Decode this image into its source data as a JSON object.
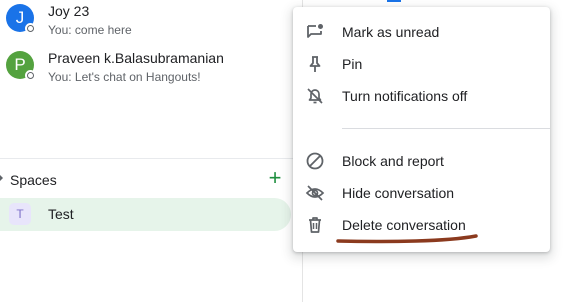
{
  "contacts": [
    {
      "initial": "J",
      "name": "Joy 23",
      "preview": "You: come here",
      "color": "#1a73e8"
    },
    {
      "initial": "P",
      "name": "Praveen k.Balasubramanian",
      "preview": "You: Let's chat on Hangouts!",
      "color": "#54a23f"
    }
  ],
  "spaces": {
    "header": "Spaces",
    "add_icon": "plus-icon",
    "items": [
      {
        "initial": "T",
        "name": "Test"
      }
    ]
  },
  "context_menu": {
    "items": [
      {
        "label": "Mark as unread",
        "icon": "mark-unread-icon"
      },
      {
        "label": "Pin",
        "icon": "pin-icon"
      },
      {
        "label": "Turn notifications off",
        "icon": "notifications-off-icon"
      },
      {
        "label": "Block and report",
        "icon": "block-icon"
      },
      {
        "label": "Hide conversation",
        "icon": "hide-icon"
      },
      {
        "label": "Delete conversation",
        "icon": "trash-icon"
      }
    ]
  },
  "colors": {
    "accent_green": "#1e8e3e",
    "selected_row": "#e6f4ea",
    "annotation": "#8b3a1e"
  }
}
